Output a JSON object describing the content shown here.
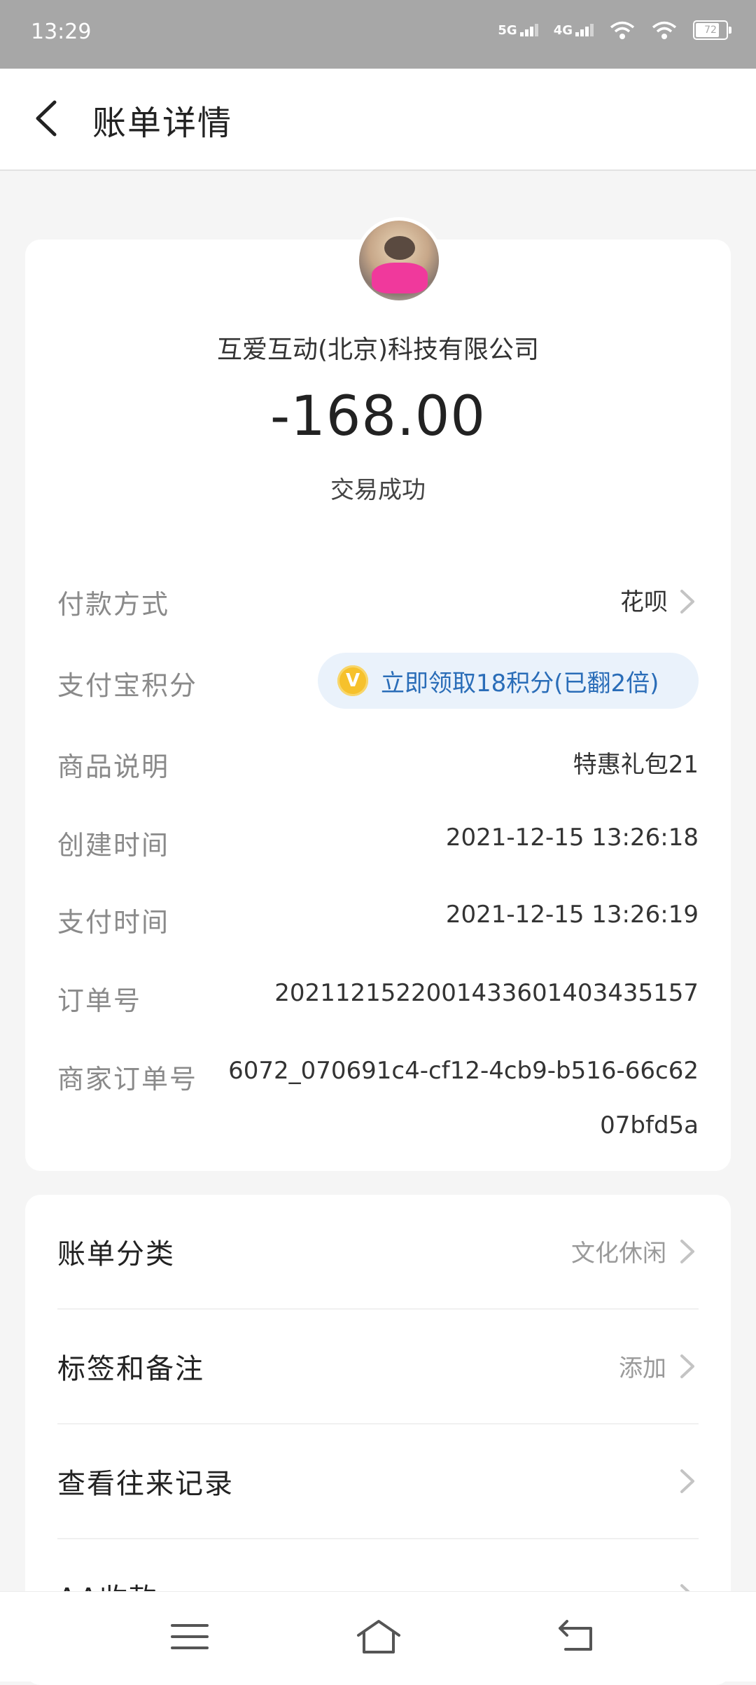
{
  "status_bar": {
    "time": "13:29",
    "network1": "5G",
    "network2": "4G",
    "battery": "72"
  },
  "header": {
    "title": "账单详情",
    "back_icon": "chevron-left-icon"
  },
  "transaction": {
    "merchant": "互爱互动(北京)科技有限公司",
    "amount": "-168.00",
    "status": "交易成功"
  },
  "details": {
    "payment_method": {
      "label": "付款方式",
      "value": "花呗"
    },
    "points": {
      "label": "支付宝积分",
      "coin": "V",
      "value": "立即领取18积分(已翻2倍)"
    },
    "product": {
      "label": "商品说明",
      "value": "特惠礼包21"
    },
    "created": {
      "label": "创建时间",
      "value": "2021-12-15 13:26:18"
    },
    "paid": {
      "label": "支付时间",
      "value": "2021-12-15 13:26:19"
    },
    "order_no": {
      "label": "订单号",
      "value": "2021121522001433601403435157"
    },
    "merchant_order_no": {
      "label": "商家订单号",
      "value": "6072_070691c4-cf12-4cb9-b516-66c6207bfd5a"
    }
  },
  "actions": [
    {
      "label": "账单分类",
      "value": "文化休闲"
    },
    {
      "label": "标签和备注",
      "value": "添加"
    },
    {
      "label": "查看往来记录",
      "value": ""
    },
    {
      "label": "AA收款",
      "value": ""
    }
  ],
  "colors": {
    "status_bar": "#a7a7a7",
    "accent_blue": "#2a6db8",
    "coin": "#f6c12c",
    "avatar_coat": "#f0399c"
  }
}
